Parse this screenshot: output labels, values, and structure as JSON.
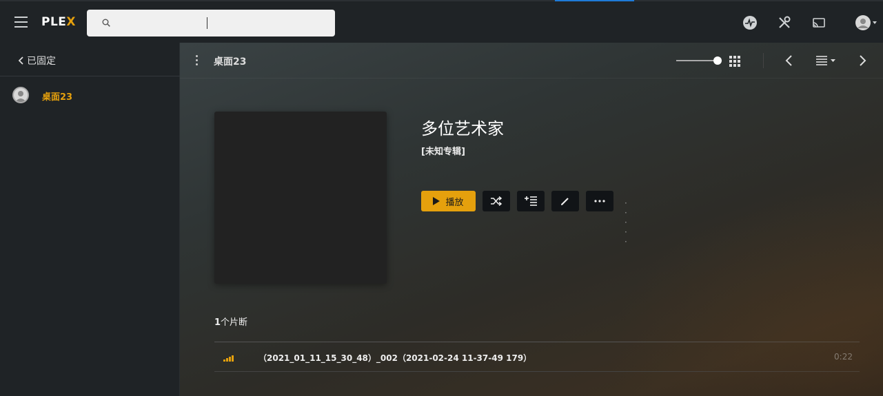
{
  "app": {
    "logo_main": "PLE",
    "logo_x": "X"
  },
  "search": {
    "placeholder": "",
    "value": ""
  },
  "sidebar": {
    "pinned_label": "已固定",
    "items": [
      {
        "label": "桌面23"
      }
    ]
  },
  "subbar": {
    "title": "桌面23"
  },
  "album": {
    "artist": "多位艺术家",
    "title": "[未知专辑]",
    "play_label": "播放",
    "extra_dots": "· · · · ·"
  },
  "tracks": {
    "count_num": "1",
    "count_label": "个片断",
    "items": [
      {
        "name": "（2021_01_11_15_30_48）_002（2021-02-24 11-37-49 179）",
        "duration": "0:22"
      }
    ]
  },
  "colors": {
    "accent": "#e5a00d",
    "tab_indicator": "#1e7bd8"
  },
  "icons": [
    "menu-icon",
    "search-icon",
    "activity-icon",
    "settings-tools-icon",
    "cast-icon",
    "user-avatar-icon",
    "chevron-left-icon",
    "kebab-icon",
    "grid-view-icon",
    "list-view-icon",
    "chevron-right-icon",
    "shuffle-icon",
    "add-to-queue-icon",
    "edit-icon",
    "more-icon",
    "now-playing-bars-icon"
  ]
}
